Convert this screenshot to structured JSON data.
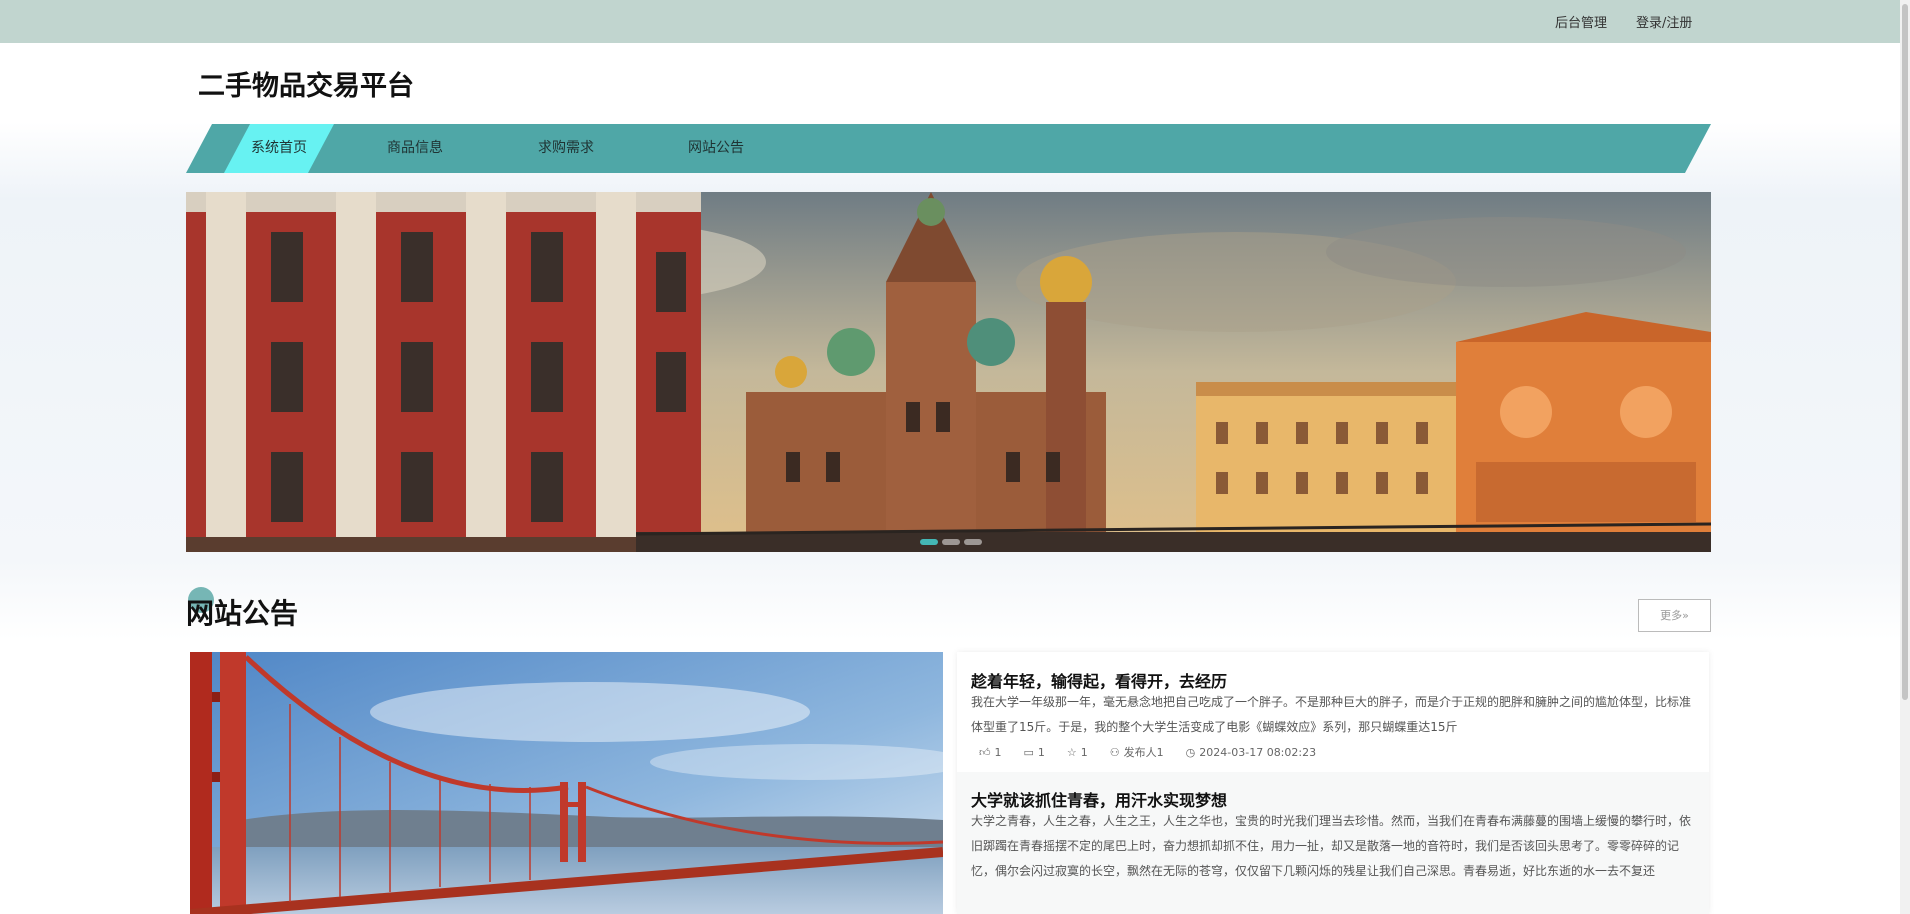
{
  "topbar": {
    "admin_label": "后台管理",
    "login_label": "登录/注册"
  },
  "site": {
    "title": "二手物品交易平台"
  },
  "nav": {
    "items": [
      {
        "label": "系统首页",
        "active": true
      },
      {
        "label": "商品信息",
        "active": false
      },
      {
        "label": "求购需求",
        "active": false
      },
      {
        "label": "网站公告",
        "active": false
      }
    ]
  },
  "banner": {
    "slides_count": 3,
    "active_slide": 1
  },
  "notice_section": {
    "title": "网站公告",
    "more_label": "更多»"
  },
  "news": [
    {
      "title": "趁着年轻，输得起，看得开，去经历",
      "excerpt": "我在大学一年级那一年，毫无悬念地把自己吃成了一个胖子。不是那种巨大的胖子，而是介于正规的肥胖和臃肿之间的尴尬体型，比标准体型重了15斤。于是，我的整个大学生活变成了电影《蝴蝶效应》系列，那只蝴蝶重达15斤",
      "likes": "1",
      "comments": "1",
      "stars": "1",
      "author": "发布人1",
      "time": "2024-03-17 08:02:23"
    },
    {
      "title": "大学就该抓住青春，用汗水实现梦想",
      "excerpt": "大学之青春，人生之春，人生之王，人生之华也，宝贵的时光我们理当去珍惜。然而，当我们在青春布满藤蔓的围墙上缓慢的攀行时，依旧踯躅在青春摇摆不定的尾巴上时，奋力想抓却抓不住，用力一扯，却又是散落一地的音符时，我们是否该回头思考了。零零碎碎的记忆，偶尔会闪过寂寞的长空，飘然在无际的苍穹，仅仅留下几颗闪烁的残星让我们自己深思。青春易逝，好比东逝的水一去不复还"
    }
  ],
  "colors": {
    "topbar": "#c1d5cf",
    "nav": "#4fa7a7",
    "nav_active": "#67f2f2",
    "accent": "#5fa9a8"
  }
}
